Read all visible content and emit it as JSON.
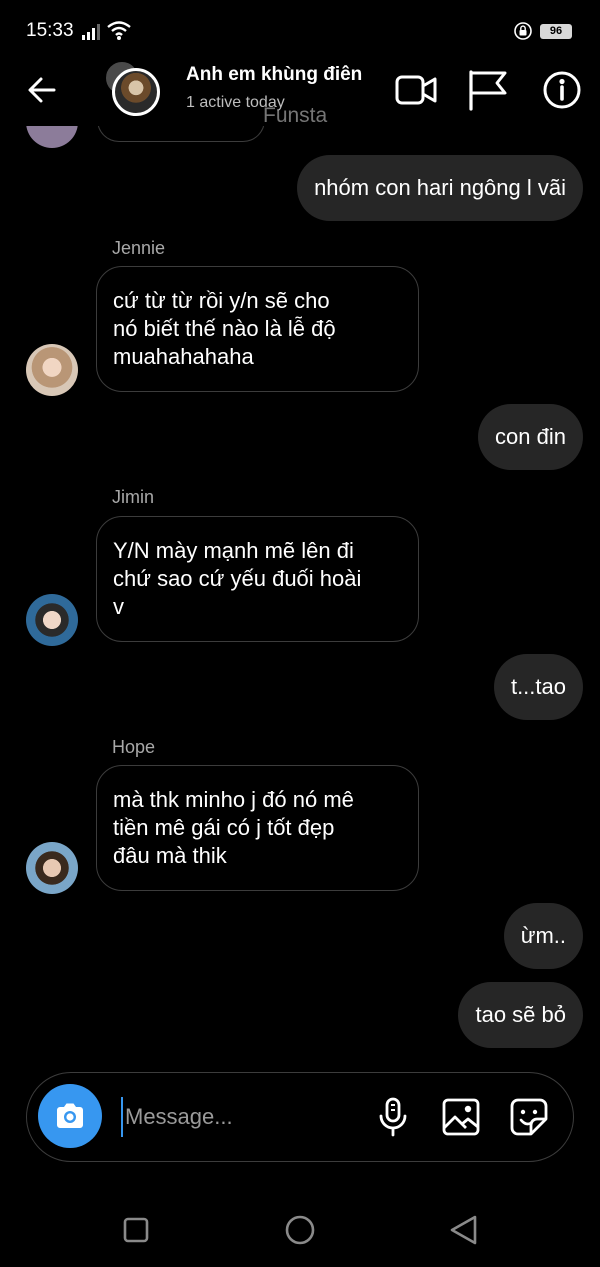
{
  "status": {
    "time": "15:33",
    "battery": "96"
  },
  "header": {
    "title": "Anh em khùng điên",
    "subtitle": "1 active today",
    "watermark": "Funsta"
  },
  "messages": [
    {
      "direction": "outgoing",
      "text": "nhóm con hari ngông l vãi"
    },
    {
      "direction": "incoming",
      "sender": "Jennie",
      "lines": [
        "cứ từ từ rồi y/n sẽ cho",
        "nó biết thế nào là lễ độ",
        "muahahahaha"
      ]
    },
    {
      "direction": "outgoing",
      "text": "con đin"
    },
    {
      "direction": "incoming",
      "sender": "Jimin",
      "lines": [
        "Y/N mày mạnh mẽ lên đi",
        "chứ sao cứ yếu đuối hoài",
        "v"
      ]
    },
    {
      "direction": "outgoing",
      "text": "t...tao"
    },
    {
      "direction": "incoming",
      "sender": "Hope",
      "lines": [
        "mà thk minho j đó nó mê",
        "tiền mê gái có j tốt đẹp",
        "đâu mà thik"
      ]
    },
    {
      "direction": "outgoing",
      "text": "ừm.."
    },
    {
      "direction": "outgoing",
      "text": "tao sẽ bỏ"
    }
  ],
  "composer": {
    "placeholder": "Message..."
  },
  "colors": {
    "background": "#000000",
    "outgoing_bubble": "#262626",
    "incoming_border": "#3c3c3c",
    "accent": "#3797f0"
  },
  "icons": {
    "back": "arrow-left-icon",
    "video": "video-camera-icon",
    "flag": "flag-icon",
    "info": "info-icon",
    "camera": "camera-icon",
    "mic": "microphone-icon",
    "gallery": "image-icon",
    "sticker": "sticker-icon"
  }
}
